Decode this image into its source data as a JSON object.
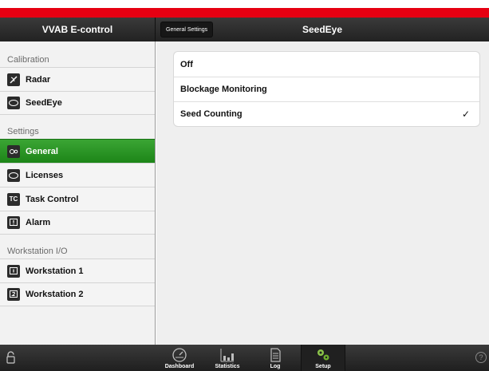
{
  "app": {
    "title": "VVAB E-control"
  },
  "header": {
    "back_label": "General Settings",
    "title": "SeedEye"
  },
  "sidebar": {
    "sections": [
      {
        "title": "Calibration",
        "items": [
          {
            "label": "Radar",
            "icon": "radar-icon"
          },
          {
            "label": "SeedEye",
            "icon": "seedeye-icon"
          }
        ]
      },
      {
        "title": "Settings",
        "items": [
          {
            "label": "General",
            "icon": "general-icon",
            "active": true
          },
          {
            "label": "Licenses",
            "icon": "licenses-icon"
          },
          {
            "label": "Task Control",
            "icon": "task-control-icon"
          },
          {
            "label": "Alarm",
            "icon": "alarm-icon"
          }
        ]
      },
      {
        "title": "Workstation I/O",
        "items": [
          {
            "label": "Workstation 1",
            "icon": "workstation-1-icon"
          },
          {
            "label": "Workstation 2",
            "icon": "workstation-2-icon"
          }
        ]
      }
    ]
  },
  "options": [
    {
      "label": "Off",
      "selected": false
    },
    {
      "label": "Blockage Monitoring",
      "selected": false
    },
    {
      "label": "Seed Counting",
      "selected": true
    }
  ],
  "check_glyph": "✓",
  "tabbar": {
    "tabs": [
      {
        "label": "Dashboard",
        "icon": "dashboard-icon"
      },
      {
        "label": "Statistics",
        "icon": "statistics-icon"
      },
      {
        "label": "Log",
        "icon": "log-icon"
      },
      {
        "label": "Setup",
        "icon": "setup-icon",
        "active": true
      }
    ],
    "help_glyph": "?"
  },
  "colors": {
    "accent_red": "#e60012",
    "active_green": "#2a9a24",
    "setup_icon_green": "#8bc34a"
  }
}
